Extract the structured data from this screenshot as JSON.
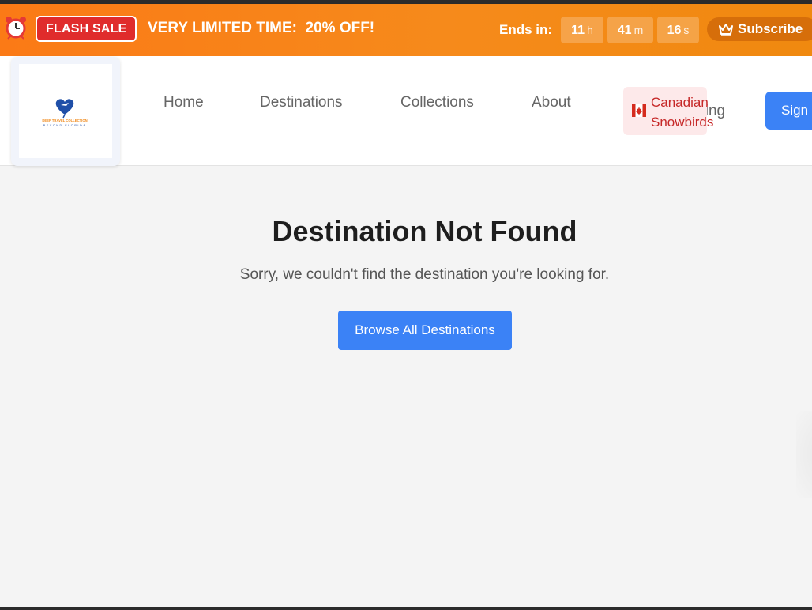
{
  "promo": {
    "badge": "FLASH SALE",
    "headline": "VERY LIMITED TIME:  20% OFF!",
    "ends_label": "Ends in:",
    "countdown": {
      "hours": "11",
      "hours_unit": "h",
      "minutes": "41",
      "minutes_unit": "m",
      "seconds": "16",
      "seconds_unit": "s"
    },
    "subscribe_label": "Subscribe"
  },
  "header": {
    "logo_text_top": "DEEP TRAVEL COLLECTION",
    "logo_text_bottom": "BEYOND FLORIDA",
    "nav": [
      "Home",
      "Destinations",
      "Collections",
      "About"
    ],
    "snowbird_line1": "Canadian",
    "snowbird_line2": "Snowbirds",
    "pricing_label": "Pricing",
    "signin_label": "Sign In"
  },
  "main": {
    "title": "Destination Not Found",
    "message": "Sorry, we couldn't find the destination you're looking for.",
    "browse_label": "Browse All Destinations"
  },
  "colors": {
    "promo_orange": "#f68a1b",
    "badge_red": "#e02c2c",
    "primary_blue": "#3b82f6",
    "snowbird_red": "#c62828"
  }
}
